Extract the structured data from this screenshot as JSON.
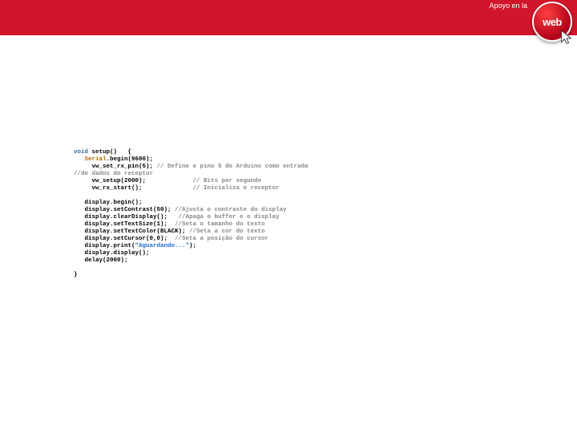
{
  "header": {
    "apoyo_label": "Apoyo en la",
    "badge_text": "web"
  },
  "code": {
    "line01_kw": "void",
    "line01_rest": " setup()   {",
    "line02_indent": "   ",
    "line02_cls": "Serial",
    "line02_rest": ".begin(9600);",
    "line03_indent": "     ",
    "line03_fn": "vw_set_rx_pin(5); ",
    "line03_cmt": "// Define o pino 5 do Arduino como entrada",
    "line04_cmt": "//de dados do receptor",
    "line05_indent": "     ",
    "line05_fn": "vw_setup(2000);             ",
    "line05_cmt": "// Bits por segundo",
    "line06_indent": "     ",
    "line06_fn": "vw_rx_start();              ",
    "line06_cmt": "// Inicializa o receptor",
    "line07_blank": "",
    "line08": "   display.begin();",
    "line09_a": "   display.setContrast(50); ",
    "line09_cmt": "//Ajusta o contraste do display",
    "line10_a": "   display.clearDisplay();   ",
    "line10_cmt": "//Apaga o buffer e o display",
    "line11_a": "   display.setTextSize(1);  ",
    "line11_cmt": "//Seta o tamanho do texto",
    "line12_a": "   display.setTextColor(BLACK); ",
    "line12_cmt": "//Seta a cor do texto",
    "line13_a": "   display.setCursor(0,0);  ",
    "line13_cmt": "//Seta a posição do cursor",
    "line14_a": "   display.print(",
    "line14_str": "\"Aguardando...\"",
    "line14_b": ");",
    "line15": "   display.display();",
    "line16": "   delay(2000);",
    "line17_blank": "",
    "line18": "}"
  }
}
